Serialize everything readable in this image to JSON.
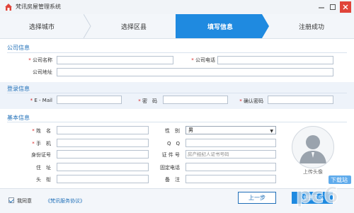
{
  "window": {
    "title": "梵讯房屋管理系统"
  },
  "steps": [
    {
      "label": "选择城市"
    },
    {
      "label": "选择区县"
    },
    {
      "label": "填写信息"
    },
    {
      "label": "注册成功"
    }
  ],
  "company": {
    "title": "公司信息",
    "name_label": "公司名称",
    "phone_label": "公司电话",
    "address_label": "公司地址"
  },
  "login": {
    "title": "登录信息",
    "email_label": "E - Mail",
    "password_label": "密　码",
    "confirm_label": "确认密码"
  },
  "basic": {
    "title": "基本信息",
    "name_label": "姓　名",
    "gender_label": "性　别",
    "gender_value": "男",
    "mobile_label": "手　机",
    "qq_label": "Q　Q",
    "idcard_label": "身份证号",
    "cert_label": "证 件 号",
    "cert_placeholder": "房产经纪人证书号码",
    "address_label": "住　址",
    "fixed_phone_label": "固定电话",
    "street_label": "头　衔",
    "note_label": "备　注"
  },
  "avatar": {
    "caption": "上传头像"
  },
  "footer": {
    "agree_text": "我同意",
    "agree_link": "《梵讯服务协议》",
    "prev_label": "上一步",
    "next_label": "注册完成"
  },
  "watermark": {
    "text": "pc6",
    "sub": "下载站"
  },
  "colors": {
    "accent": "#1f8ae0",
    "section": "#1f6fb8",
    "required": "#d61b1b",
    "close": "#e0443a"
  }
}
